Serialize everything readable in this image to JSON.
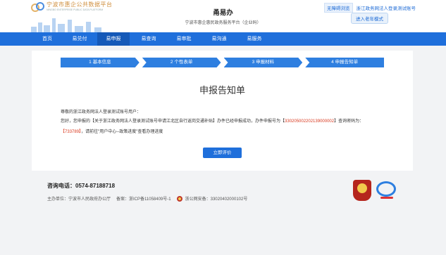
{
  "header": {
    "logo_cn": "宁波市惠企公共数据平台",
    "logo_en": "NINGBO ENTERPRISE PUBLIC DATA PLATFORM",
    "title": "甬易办",
    "subtitle": "宁波市惠企惠民政务服务平台（企业码）",
    "accessible_label": "无障碍浏览",
    "user_name": "浙江政务网法人登录测试账号",
    "elder_mode_label": "进入老年模式"
  },
  "nav": {
    "items": [
      {
        "label": "首页"
      },
      {
        "label": "易兑付"
      },
      {
        "label": "易申报"
      },
      {
        "label": "易查询"
      },
      {
        "label": "易审批"
      },
      {
        "label": "易沟通"
      },
      {
        "label": "易服务"
      }
    ],
    "active_index": 2
  },
  "steps": [
    {
      "label": "1 基本信息"
    },
    {
      "label": "2 个性表单"
    },
    {
      "label": "3 申报材料"
    },
    {
      "label": "4 申报告知单"
    }
  ],
  "notice": {
    "title": "申报告知单",
    "greeting": "尊敬的浙江政务网法人登录测试账号用户：",
    "p1": "您好，您申报的【关于浙江政务网法人登录测试账号申请江北区自行返岗交通补贴】办件已经申报成功，办件申报号为【",
    "app_no": "330205002202139000002",
    "p2": "】查询密码为：",
    "pwd_open": "【",
    "password": "733789",
    "pwd_close": "】",
    "p3": "，请前往\"用户中心--政策进度\"查看办理进度",
    "evaluate_label": "立即评价"
  },
  "footer": {
    "phone_label": "咨询电话：",
    "phone": "0574-87188718",
    "sponsor": "主办单位：宁波市人民政府办公厅",
    "icp": "备案：浙ICP备11058409号-1",
    "security": "浙公网安备：33020402000102号"
  },
  "colors": {
    "primary": "#1f6fdb",
    "highlight": "#d9381e"
  }
}
